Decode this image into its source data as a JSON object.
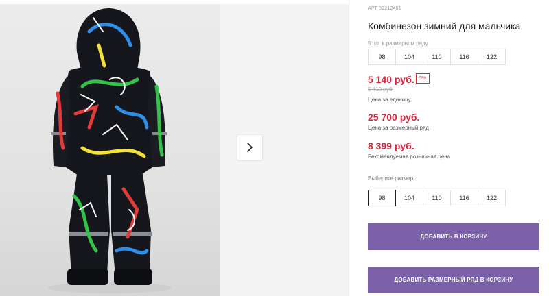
{
  "product": {
    "article": "АРТ 32212401",
    "title": "Комбинезон зимний для мальчика",
    "pack_label": "5 шт. в размерном ряду",
    "pack_sizes": [
      "98",
      "104",
      "110",
      "116",
      "122"
    ],
    "price_unit": "5 140 руб.",
    "discount": "5%",
    "price_old": "5 410 руб.",
    "price_unit_caption": "Цена за единицу",
    "price_range": "25 700 руб.",
    "price_range_caption": "Цена за размерный ряд",
    "price_retail": "8 399 руб.",
    "price_retail_caption": "Рекомендуемая розничная цена",
    "choose_size_label": "Выберите размер:",
    "size_options": [
      "98",
      "104",
      "110",
      "116",
      "122"
    ],
    "selected_size": "98",
    "add_to_cart_label": "ДОБАВИТЬ В КОРЗИНУ",
    "add_range_label": "ДОБАВИТЬ РАЗМЕРНЫЙ РЯД В КОРЗИНУ"
  },
  "gallery": {
    "next_icon": "chevron-right-icon"
  },
  "colors": {
    "accent": "#7b61a8",
    "price": "#d7263d"
  }
}
